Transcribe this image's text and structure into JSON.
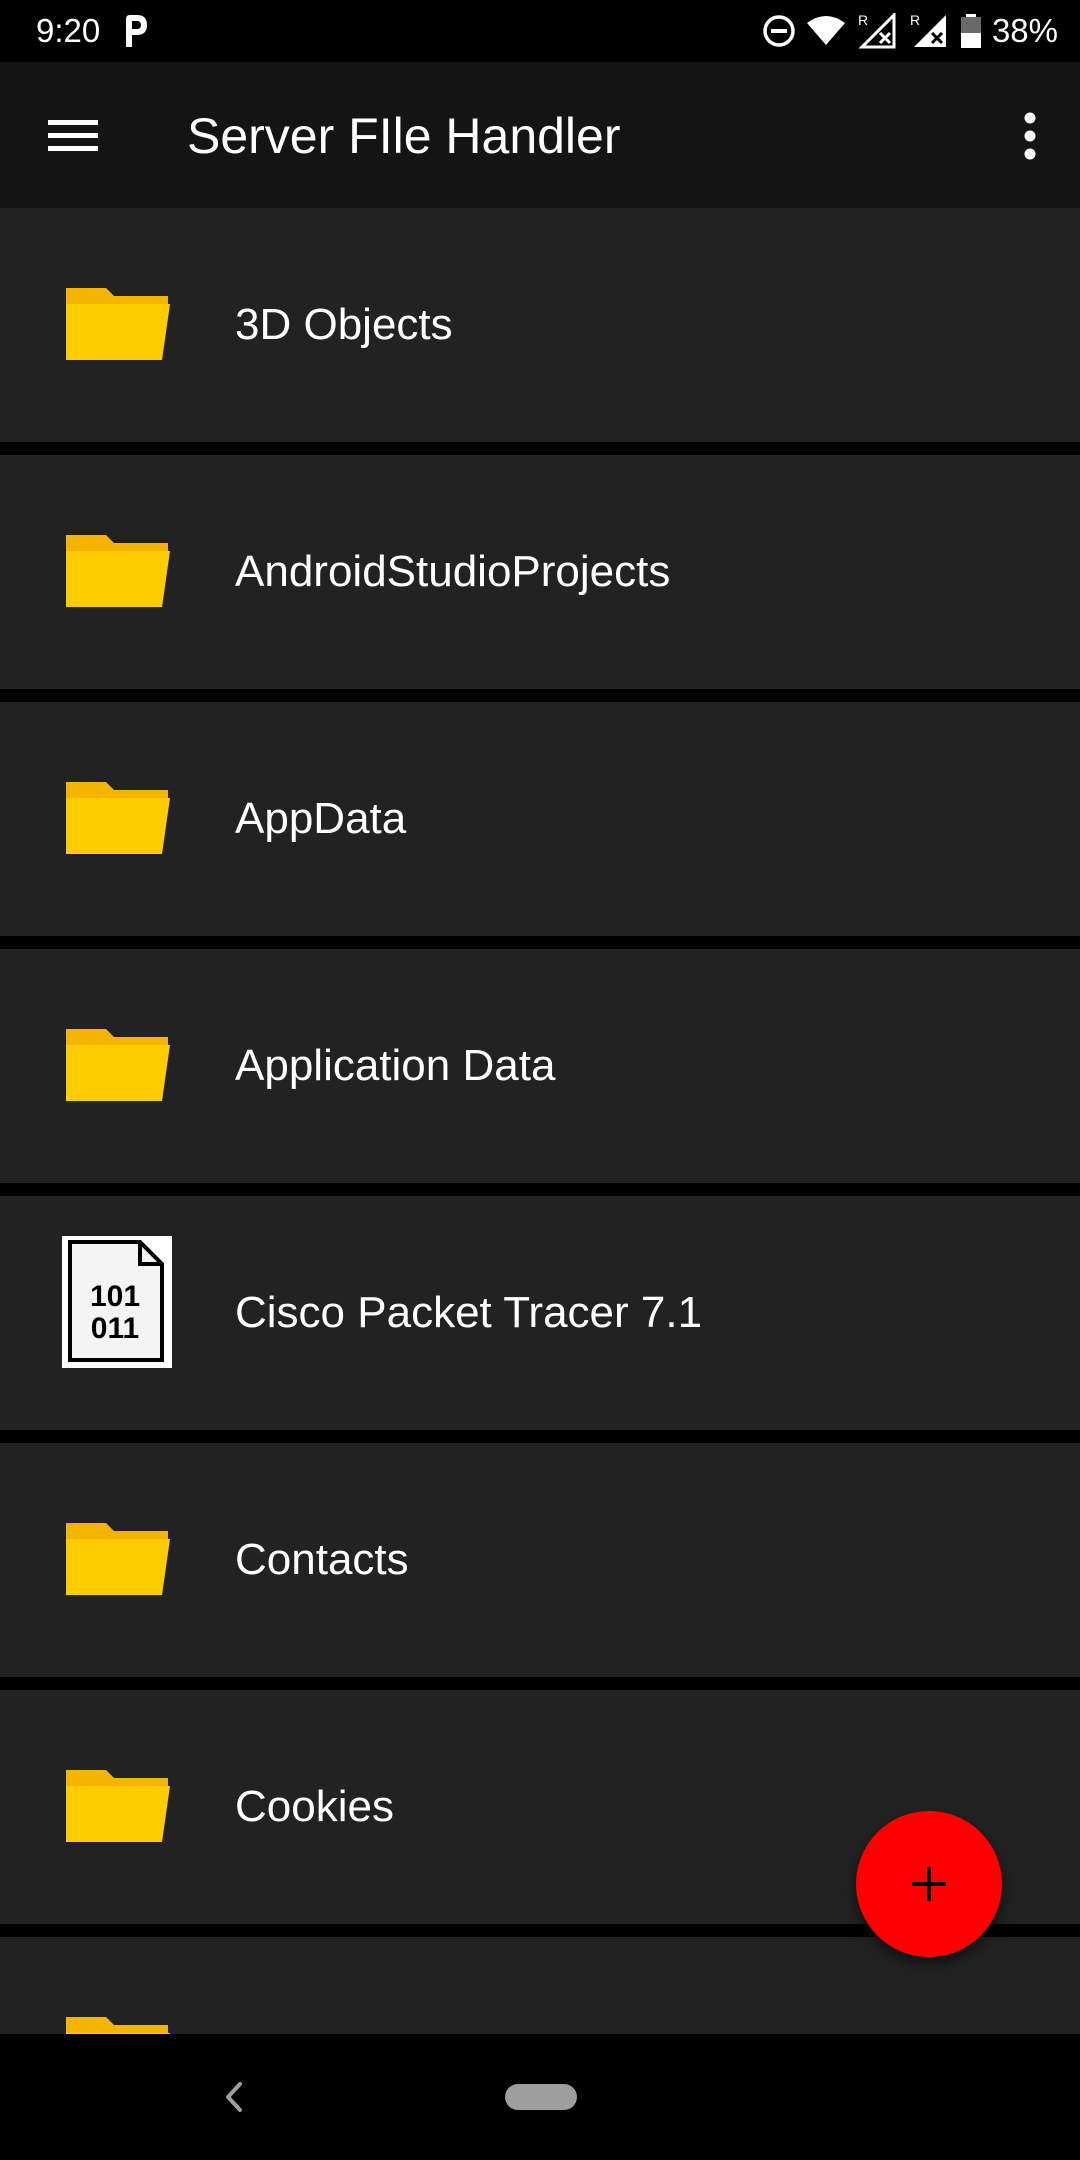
{
  "status_bar": {
    "time": "9:20",
    "battery_percent": "38%",
    "roaming_indicator_1": "R",
    "roaming_indicator_2": "R"
  },
  "app_bar": {
    "title": "Server FIle Handler"
  },
  "files": [
    {
      "name": "3D Objects",
      "type": "folder"
    },
    {
      "name": "AndroidStudioProjects",
      "type": "folder"
    },
    {
      "name": "AppData",
      "type": "folder"
    },
    {
      "name": "Application Data",
      "type": "folder"
    },
    {
      "name": "Cisco Packet Tracer 7.1",
      "type": "binary-file"
    },
    {
      "name": "Contacts",
      "type": "folder"
    },
    {
      "name": "Cookies",
      "type": "folder"
    },
    {
      "name": "",
      "type": "folder"
    }
  ],
  "binary_icon_text": {
    "line1": "101",
    "line2": "011"
  },
  "colors": {
    "folder": "#FFCC00",
    "folder_tab": "#F5B400",
    "fab": "#FF0000",
    "row_background": "#222222",
    "app_bar": "#141414"
  },
  "icons": {
    "menu": "hamburger-menu-icon",
    "overflow": "more-vert-icon",
    "fab": "add-icon",
    "folder": "folder-icon",
    "binary_file": "binary-file-icon"
  }
}
